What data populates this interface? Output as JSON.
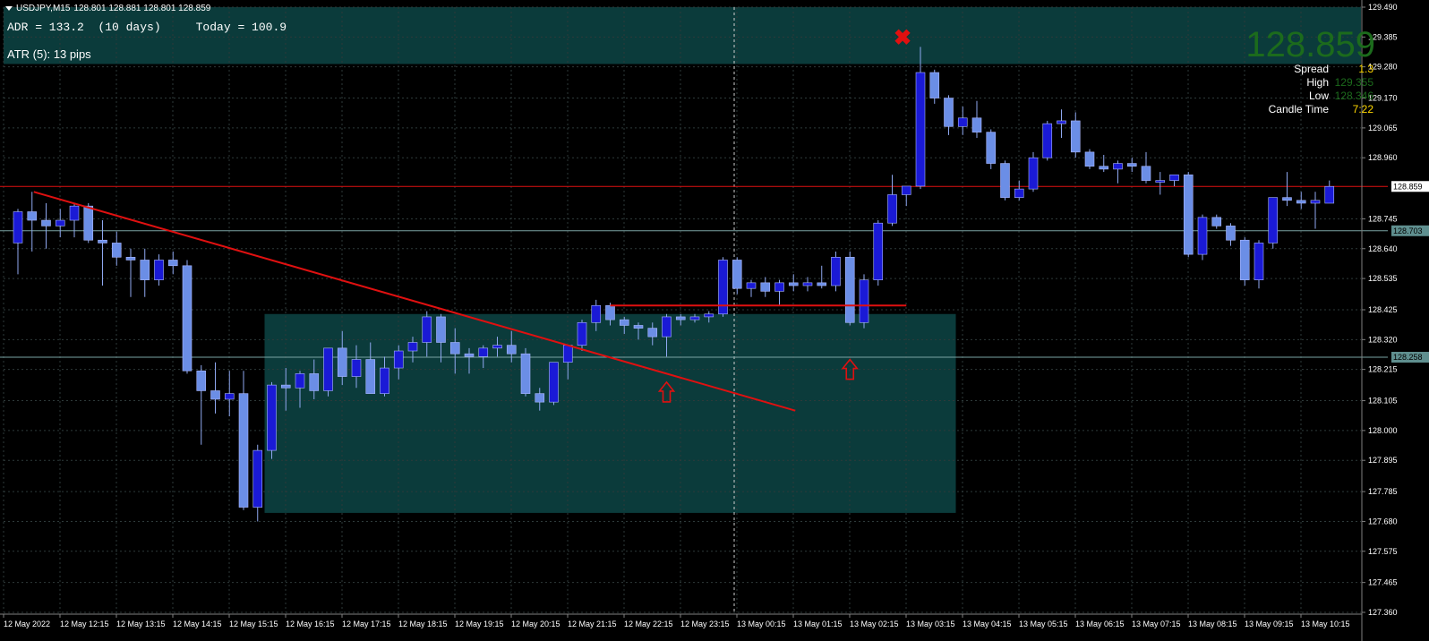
{
  "header": {
    "symbol": "USDJPY,M15",
    "ohlc": "128.801 128.881 128.801 128.859"
  },
  "indicators": {
    "adr_text": "ADR = 133.2  (10 days)     Today = 100.9",
    "atr_text": "ATR (5): 13 pips"
  },
  "info_panel": {
    "price": "128.859",
    "rows": [
      {
        "label": "Spread",
        "value": "1.3",
        "color": "#ffd700"
      },
      {
        "label": "High",
        "value": "129.355",
        "color": "#1c6b1c"
      },
      {
        "label": "Low",
        "value": "128.346",
        "color": "#1c6b1c"
      },
      {
        "label": "Candle Time",
        "value": "7:22",
        "color": "#ffd700"
      }
    ]
  },
  "price_axis": {
    "ticks": [
      "129.490",
      "129.385",
      "129.280",
      "129.170",
      "129.065",
      "128.960",
      "128.745",
      "128.640",
      "128.535",
      "128.425",
      "128.320",
      "128.215",
      "128.105",
      "128.000",
      "127.895",
      "127.785",
      "127.680",
      "127.575",
      "127.465",
      "127.360"
    ],
    "current_tag": "128.859",
    "level_tags": [
      "128.703",
      "128.258"
    ]
  },
  "time_axis": {
    "labels": [
      "12 May 2022",
      "12 May 12:15",
      "12 May 13:15",
      "12 May 14:15",
      "12 May 15:15",
      "12 May 16:15",
      "12 May 17:15",
      "12 May 18:15",
      "12 May 19:15",
      "12 May 20:15",
      "12 May 21:15",
      "12 May 22:15",
      "12 May 23:15",
      "13 May 00:15",
      "13 May 01:15",
      "13 May 02:15",
      "13 May 03:15",
      "13 May 04:15",
      "13 May 05:15",
      "13 May 06:15",
      "13 May 07:15",
      "13 May 08:15",
      "13 May 09:15",
      "13 May 10:15"
    ]
  },
  "colors": {
    "bull": "#6b8ee6",
    "bear": "#1a1ad6",
    "wick": "#8fa8f0",
    "grid": "#2e3a3a",
    "zone": "#0b3b3b",
    "trend": "#e01010",
    "level": "#7aa3a3"
  },
  "chart_data": {
    "type": "candlestick",
    "symbol": "USDJPY",
    "timeframe": "M15",
    "ylim": [
      127.36,
      129.49
    ],
    "levels": {
      "current": 128.859,
      "support_1": 128.703,
      "support_2": 128.258
    },
    "candles": [
      {
        "o": 128.66,
        "h": 128.78,
        "l": 128.55,
        "c": 128.77
      },
      {
        "o": 128.77,
        "h": 128.84,
        "l": 128.63,
        "c": 128.74
      },
      {
        "o": 128.74,
        "h": 128.8,
        "l": 128.64,
        "c": 128.72
      },
      {
        "o": 128.72,
        "h": 128.78,
        "l": 128.68,
        "c": 128.74
      },
      {
        "o": 128.74,
        "h": 128.8,
        "l": 128.68,
        "c": 128.79
      },
      {
        "o": 128.79,
        "h": 128.8,
        "l": 128.66,
        "c": 128.67
      },
      {
        "o": 128.67,
        "h": 128.74,
        "l": 128.51,
        "c": 128.66
      },
      {
        "o": 128.66,
        "h": 128.7,
        "l": 128.58,
        "c": 128.61
      },
      {
        "o": 128.61,
        "h": 128.64,
        "l": 128.47,
        "c": 128.6
      },
      {
        "o": 128.6,
        "h": 128.64,
        "l": 128.47,
        "c": 128.53
      },
      {
        "o": 128.53,
        "h": 128.62,
        "l": 128.51,
        "c": 128.6
      },
      {
        "o": 128.6,
        "h": 128.63,
        "l": 128.55,
        "c": 128.58
      },
      {
        "o": 128.58,
        "h": 128.6,
        "l": 128.2,
        "c": 128.21
      },
      {
        "o": 128.21,
        "h": 128.23,
        "l": 127.95,
        "c": 128.14
      },
      {
        "o": 128.14,
        "h": 128.24,
        "l": 128.06,
        "c": 128.11
      },
      {
        "o": 128.11,
        "h": 128.21,
        "l": 128.05,
        "c": 128.13
      },
      {
        "o": 128.13,
        "h": 128.21,
        "l": 127.72,
        "c": 127.73
      },
      {
        "o": 127.73,
        "h": 127.95,
        "l": 127.68,
        "c": 127.93
      },
      {
        "o": 127.93,
        "h": 128.17,
        "l": 127.9,
        "c": 128.16
      },
      {
        "o": 128.16,
        "h": 128.22,
        "l": 128.07,
        "c": 128.15
      },
      {
        "o": 128.15,
        "h": 128.21,
        "l": 128.08,
        "c": 128.2
      },
      {
        "o": 128.2,
        "h": 128.25,
        "l": 128.11,
        "c": 128.14
      },
      {
        "o": 128.14,
        "h": 128.29,
        "l": 128.12,
        "c": 128.29
      },
      {
        "o": 128.29,
        "h": 128.35,
        "l": 128.16,
        "c": 128.19
      },
      {
        "o": 128.19,
        "h": 128.3,
        "l": 128.15,
        "c": 128.25
      },
      {
        "o": 128.25,
        "h": 128.31,
        "l": 128.13,
        "c": 128.13
      },
      {
        "o": 128.13,
        "h": 128.26,
        "l": 128.12,
        "c": 128.22
      },
      {
        "o": 128.22,
        "h": 128.3,
        "l": 128.18,
        "c": 128.28
      },
      {
        "o": 128.28,
        "h": 128.33,
        "l": 128.24,
        "c": 128.31
      },
      {
        "o": 128.31,
        "h": 128.42,
        "l": 128.26,
        "c": 128.4
      },
      {
        "o": 128.4,
        "h": 128.41,
        "l": 128.24,
        "c": 128.31
      },
      {
        "o": 128.31,
        "h": 128.36,
        "l": 128.2,
        "c": 128.27
      },
      {
        "o": 128.27,
        "h": 128.29,
        "l": 128.2,
        "c": 128.26
      },
      {
        "o": 128.26,
        "h": 128.3,
        "l": 128.22,
        "c": 128.29
      },
      {
        "o": 128.29,
        "h": 128.33,
        "l": 128.26,
        "c": 128.3
      },
      {
        "o": 128.3,
        "h": 128.35,
        "l": 128.24,
        "c": 128.27
      },
      {
        "o": 128.27,
        "h": 128.29,
        "l": 128.12,
        "c": 128.13
      },
      {
        "o": 128.13,
        "h": 128.15,
        "l": 128.07,
        "c": 128.1
      },
      {
        "o": 128.1,
        "h": 128.24,
        "l": 128.09,
        "c": 128.24
      },
      {
        "o": 128.24,
        "h": 128.3,
        "l": 128.18,
        "c": 128.3
      },
      {
        "o": 128.3,
        "h": 128.39,
        "l": 128.28,
        "c": 128.38
      },
      {
        "o": 128.38,
        "h": 128.46,
        "l": 128.35,
        "c": 128.44
      },
      {
        "o": 128.44,
        "h": 128.45,
        "l": 128.37,
        "c": 128.39
      },
      {
        "o": 128.39,
        "h": 128.4,
        "l": 128.34,
        "c": 128.37
      },
      {
        "o": 128.37,
        "h": 128.38,
        "l": 128.32,
        "c": 128.36
      },
      {
        "o": 128.36,
        "h": 128.38,
        "l": 128.3,
        "c": 128.33
      },
      {
        "o": 128.33,
        "h": 128.41,
        "l": 128.26,
        "c": 128.4
      },
      {
        "o": 128.4,
        "h": 128.41,
        "l": 128.37,
        "c": 128.39
      },
      {
        "o": 128.39,
        "h": 128.41,
        "l": 128.38,
        "c": 128.4
      },
      {
        "o": 128.4,
        "h": 128.42,
        "l": 128.38,
        "c": 128.41
      },
      {
        "o": 128.41,
        "h": 128.61,
        "l": 128.4,
        "c": 128.6
      },
      {
        "o": 128.6,
        "h": 128.61,
        "l": 128.48,
        "c": 128.5
      },
      {
        "o": 128.5,
        "h": 128.53,
        "l": 128.47,
        "c": 128.52
      },
      {
        "o": 128.52,
        "h": 128.54,
        "l": 128.47,
        "c": 128.49
      },
      {
        "o": 128.49,
        "h": 128.53,
        "l": 128.44,
        "c": 128.52
      },
      {
        "o": 128.52,
        "h": 128.55,
        "l": 128.49,
        "c": 128.51
      },
      {
        "o": 128.51,
        "h": 128.54,
        "l": 128.49,
        "c": 128.52
      },
      {
        "o": 128.52,
        "h": 128.58,
        "l": 128.5,
        "c": 128.51
      },
      {
        "o": 128.51,
        "h": 128.63,
        "l": 128.49,
        "c": 128.61
      },
      {
        "o": 128.61,
        "h": 128.63,
        "l": 128.37,
        "c": 128.38
      },
      {
        "o": 128.38,
        "h": 128.55,
        "l": 128.36,
        "c": 128.53
      },
      {
        "o": 128.53,
        "h": 128.74,
        "l": 128.51,
        "c": 128.73
      },
      {
        "o": 128.73,
        "h": 128.9,
        "l": 128.72,
        "c": 128.83
      },
      {
        "o": 128.83,
        "h": 128.86,
        "l": 128.79,
        "c": 128.86
      },
      {
        "o": 128.86,
        "h": 129.35,
        "l": 128.85,
        "c": 129.26
      },
      {
        "o": 129.26,
        "h": 129.27,
        "l": 129.15,
        "c": 129.17
      },
      {
        "o": 129.17,
        "h": 129.18,
        "l": 129.04,
        "c": 129.07
      },
      {
        "o": 129.07,
        "h": 129.14,
        "l": 129.04,
        "c": 129.1
      },
      {
        "o": 129.1,
        "h": 129.16,
        "l": 129.03,
        "c": 129.05
      },
      {
        "o": 129.05,
        "h": 129.06,
        "l": 128.92,
        "c": 128.94
      },
      {
        "o": 128.94,
        "h": 128.95,
        "l": 128.81,
        "c": 128.82
      },
      {
        "o": 128.82,
        "h": 128.88,
        "l": 128.81,
        "c": 128.85
      },
      {
        "o": 128.85,
        "h": 128.98,
        "l": 128.84,
        "c": 128.96
      },
      {
        "o": 128.96,
        "h": 129.09,
        "l": 128.95,
        "c": 129.08
      },
      {
        "o": 129.08,
        "h": 129.13,
        "l": 129.03,
        "c": 129.09
      },
      {
        "o": 129.09,
        "h": 129.12,
        "l": 128.96,
        "c": 128.98
      },
      {
        "o": 128.98,
        "h": 128.99,
        "l": 128.92,
        "c": 128.93
      },
      {
        "o": 128.93,
        "h": 128.97,
        "l": 128.91,
        "c": 128.92
      },
      {
        "o": 128.92,
        "h": 128.95,
        "l": 128.87,
        "c": 128.94
      },
      {
        "o": 128.94,
        "h": 128.96,
        "l": 128.91,
        "c": 128.93
      },
      {
        "o": 128.93,
        "h": 128.98,
        "l": 128.87,
        "c": 128.88
      },
      {
        "o": 128.88,
        "h": 128.91,
        "l": 128.83,
        "c": 128.88
      },
      {
        "o": 128.88,
        "h": 128.9,
        "l": 128.86,
        "c": 128.9
      },
      {
        "o": 128.9,
        "h": 128.91,
        "l": 128.61,
        "c": 128.62
      },
      {
        "o": 128.62,
        "h": 128.76,
        "l": 128.6,
        "c": 128.75
      },
      {
        "o": 128.75,
        "h": 128.76,
        "l": 128.71,
        "c": 128.72
      },
      {
        "o": 128.72,
        "h": 128.73,
        "l": 128.65,
        "c": 128.67
      },
      {
        "o": 128.67,
        "h": 128.68,
        "l": 128.51,
        "c": 128.53
      },
      {
        "o": 128.53,
        "h": 128.67,
        "l": 128.5,
        "c": 128.66
      },
      {
        "o": 128.66,
        "h": 128.82,
        "l": 128.64,
        "c": 128.82
      },
      {
        "o": 128.82,
        "h": 128.91,
        "l": 128.79,
        "c": 128.81
      },
      {
        "o": 128.81,
        "h": 128.84,
        "l": 128.78,
        "c": 128.8
      },
      {
        "o": 128.8,
        "h": 128.84,
        "l": 128.71,
        "c": 128.81
      },
      {
        "o": 128.8,
        "h": 128.88,
        "l": 128.8,
        "c": 128.859
      }
    ],
    "trendline": {
      "from": {
        "index": 1,
        "price": 128.84
      },
      "to": {
        "index": 55,
        "price": 128.07
      }
    },
    "horizontal_segment": {
      "from_index": 42,
      "to_index": 63,
      "price": 128.44
    },
    "zones": [
      {
        "from_index": 18,
        "to_index": 66,
        "top": 128.41,
        "bottom": 127.71
      },
      {
        "from_index": 0,
        "to_index": 95,
        "top": 129.49,
        "bottom": 129.29
      }
    ],
    "markers": [
      {
        "type": "arrow-up",
        "index": 46,
        "price": 128.17
      },
      {
        "type": "arrow-up",
        "index": 59,
        "price": 128.25
      },
      {
        "type": "cross",
        "index": 63,
        "price": 129.42
      }
    ],
    "cursor_index": 50
  }
}
